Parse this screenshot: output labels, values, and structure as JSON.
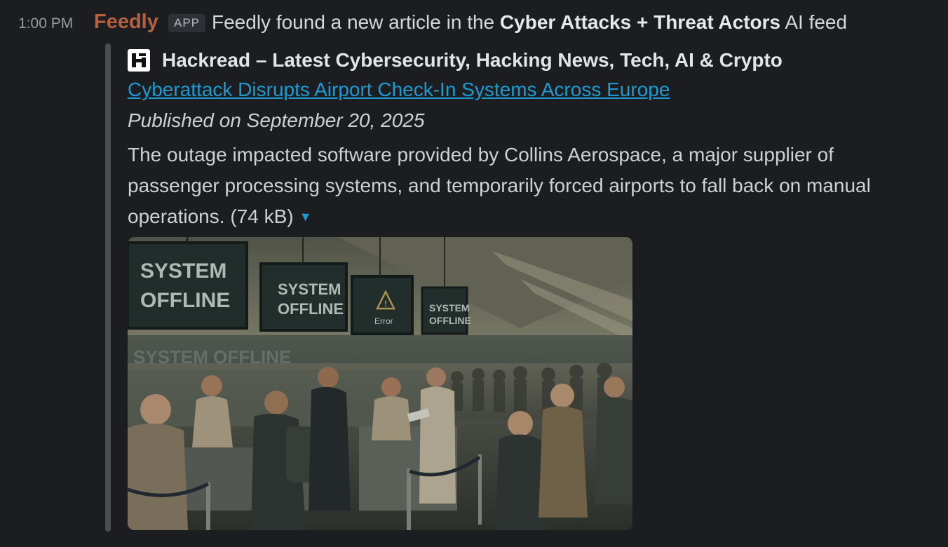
{
  "message": {
    "timestamp": "1:00 PM",
    "sender": "Feedly",
    "badge": "APP",
    "text_prefix": "Feedly found a new article in the ",
    "feed_name": "Cyber Attacks + Threat Actors",
    "text_suffix": " AI feed"
  },
  "attachment": {
    "source_icon": "hackread-logo",
    "source_name": "Hackread – Latest Cybersecurity, Hacking News, Tech, AI & Crypto",
    "title": "Cyberattack Disrupts Airport Check-In Systems Across Europe",
    "published": "Published on September 20, 2025",
    "summary": "The outage impacted software provided by Collins Aerospace, a major supplier of passenger processing systems, and temporarily forced airports to fall back on manual operations.",
    "size": "(74 kB)",
    "collapse_icon": "caret-down-icon",
    "image": {
      "signs": [
        "SYSTEM OFFLINE",
        "SYSTEM OFFLINE",
        "Error",
        "SYSTEM OFFLINE"
      ],
      "reflection": "SYSTEM OFFLINE"
    }
  },
  "colors": {
    "background": "#1b1d21",
    "sender": "#b5603f",
    "link": "#1d9bd1",
    "bar": "#4b4d52"
  }
}
